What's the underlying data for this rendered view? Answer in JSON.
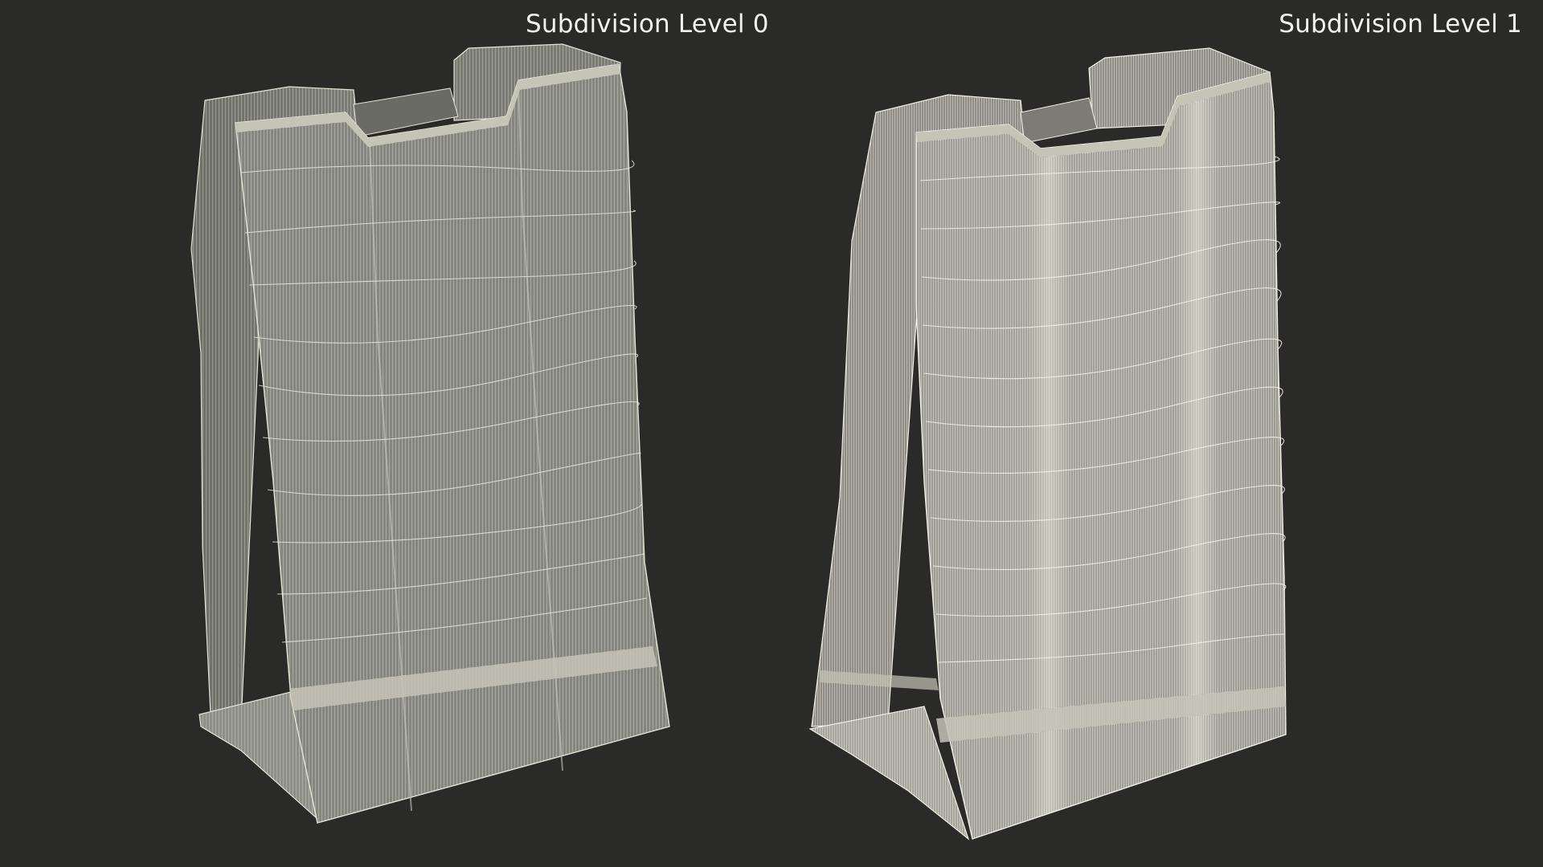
{
  "viewport": {
    "background": "#2a2a29",
    "labels": {
      "left": "Subdivision Level 0",
      "right": "Subdivision Level 1"
    }
  },
  "models": {
    "left": {
      "subject": "paper-bag-wireframe",
      "fill": "#858580",
      "wire": "#e6e5d6"
    },
    "right": {
      "subject": "paper-bag-wireframe",
      "fill": "#9a9993",
      "wire": "#f2f1e4"
    }
  }
}
